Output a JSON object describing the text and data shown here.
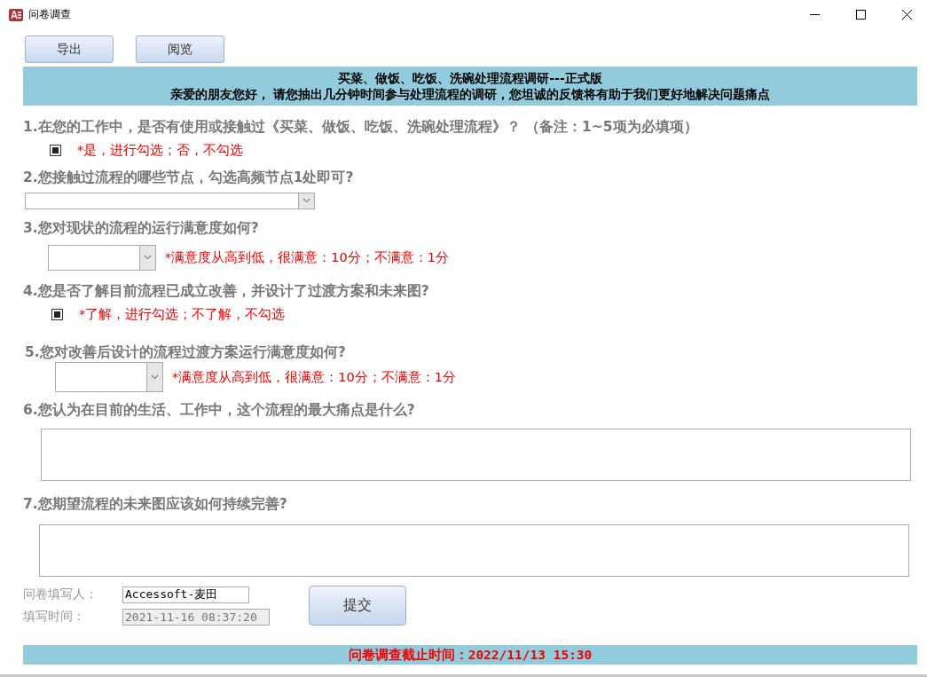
{
  "window": {
    "title": "问卷调查"
  },
  "toolbar": [
    "导出",
    "阅览"
  ],
  "banner": {
    "title": "买菜、做饭、吃饭、洗碗处理流程调研---正式版",
    "subtitle": "亲爱的朋友您好，  请您抽出几分钟时间参与处理流程的调研，您坦诚的反馈将有助于我们更好地解决问题痛点"
  },
  "questions": [
    {
      "label": "1.在您的工作中，是否有使用或接触过《买菜、做饭、吃饭、洗碗处理流程》？  （备注：1~5项为必填项）",
      "kind": "checkbox",
      "checked": true,
      "note": "*是，进行勾选；否，不勾选"
    },
    {
      "label": "2.您接触过流程的哪些节点，勾选高频节点1处即可?",
      "kind": "dropdown"
    },
    {
      "label": "3.您对现状的流程的运行满意度如何?",
      "kind": "dropdown",
      "note": "*满意度从高到低，很满意：10分；不满意：1分"
    },
    {
      "label": "4.您是否了解目前流程已成立改善，并设计了过渡方案和未来图?",
      "kind": "checkbox",
      "checked": true,
      "note": "*了解，进行勾选；不了解，不勾选"
    },
    {
      "label": "5.您对改善后设计的流程过渡方案运行满意度如何?",
      "kind": "dropdown",
      "note": "*满意度从高到低，很满意：10分；不满意：1分"
    },
    {
      "label": "6.您认为在目前的生活、工作中，这个流程的最大痛点是什么?",
      "kind": "textarea"
    },
    {
      "label": "7.您期望流程的未来图应该如何持续完善?",
      "kind": "textarea"
    }
  ],
  "form": {
    "fields": [
      {
        "label": "问卷填写人：",
        "value": "Accessoft-麦田",
        "disabled": false
      },
      {
        "label": "填写时间：",
        "value": "2021-11-16 08:37:20",
        "disabled": true
      }
    ],
    "submit": "提交"
  },
  "deadline": "问卷调查截止时间：2022/11/13 15:30"
}
